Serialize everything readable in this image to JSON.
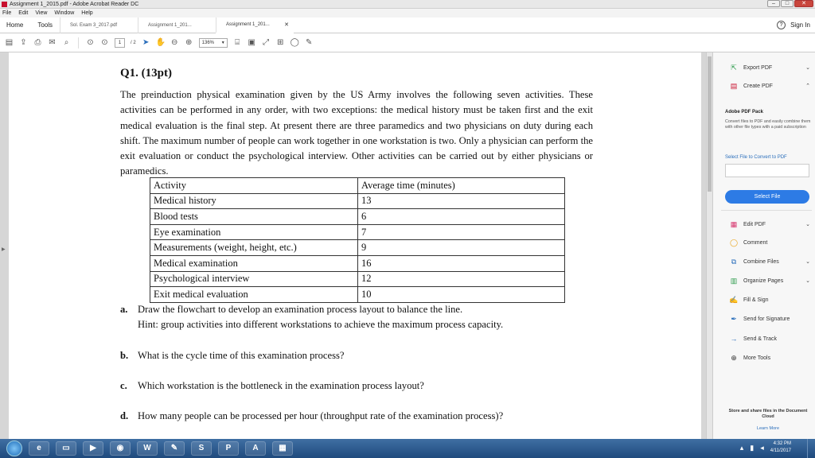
{
  "window": {
    "title": "Assignment 1_2015.pdf - Adobe Acrobat Reader DC"
  },
  "menu": [
    "File",
    "Edit",
    "View",
    "Window",
    "Help"
  ],
  "tabs": {
    "home": "Home",
    "tools": "Tools",
    "docs": [
      {
        "label": "Sol. Exam 3_2017.pdf",
        "active": false
      },
      {
        "label": "Assignment 1_201...",
        "active": false
      },
      {
        "label": "Assignment 1_201...",
        "active": true
      }
    ],
    "sign_in": "Sign In"
  },
  "toolbar": {
    "page_current": "1",
    "page_total": "/ 2",
    "zoom": "136%"
  },
  "document": {
    "question_title": "Q1. (13pt)",
    "paragraph": "The preinduction physical examination given by the US Army involves the following seven activities. These activities can be performed in any order, with two exceptions: the medical history must be taken first and the exit medical evaluation is the final step. At present there are three paramedics and two physicians on duty during each shift. The maximum number of people can work together in one workstation is two. Only a physician can perform the exit evaluation or conduct the psychological interview. Other activities can be carried out by either physicians or paramedics.",
    "table_headers": [
      "Activity",
      "Average time (minutes)"
    ],
    "table_rows": [
      [
        "Medical history",
        "13"
      ],
      [
        "Blood tests",
        "6"
      ],
      [
        "Eye examination",
        "7"
      ],
      [
        "Measurements (weight, height, etc.)",
        "9"
      ],
      [
        "Medical examination",
        "16"
      ],
      [
        "Psychological interview",
        "12"
      ],
      [
        "Exit medical evaluation",
        "10"
      ]
    ],
    "q_a_label": "a.",
    "q_a_text": "Draw the flowchart to develop an examination process layout to balance the line.",
    "q_a_hint": "Hint: group activities into different workstations to achieve the maximum process capacity.",
    "q_b_label": "b.",
    "q_b_text": "What is the cycle time of this examination process?",
    "q_c_label": "c.",
    "q_c_text": "Which workstation is the bottleneck in the examination process layout?",
    "q_d_label": "d.",
    "q_d_text": "How many people can be processed per hour (throughput rate of the examination process)?"
  },
  "right_panel": {
    "export_pdf": "Export PDF",
    "create_pdf": "Create PDF",
    "pack_title": "Adobe PDF Pack",
    "pack_desc": "Convert files to PDF and easily combine them with other file types with a paid subscription",
    "select_label": "Select File to Convert to PDF",
    "select_button": "Select File",
    "tools": [
      {
        "icon": "edit-pdf-icon",
        "label": "Edit PDF",
        "chevron": true
      },
      {
        "icon": "comment-icon",
        "label": "Comment",
        "chevron": false
      },
      {
        "icon": "combine-files-icon",
        "label": "Combine Files",
        "chevron": true
      },
      {
        "icon": "organize-pages-icon",
        "label": "Organize Pages",
        "chevron": true
      },
      {
        "icon": "fill-sign-icon",
        "label": "Fill & Sign",
        "chevron": false
      },
      {
        "icon": "send-for-signature-icon",
        "label": "Send for Signature",
        "chevron": false
      },
      {
        "icon": "send-track-icon",
        "label": "Send & Track",
        "chevron": false
      },
      {
        "icon": "more-tools-icon",
        "label": "More Tools",
        "chevron": false
      }
    ],
    "store_text": "Store and share files in the Document Cloud",
    "learn_more": "Learn More"
  },
  "taskbar": {
    "time": "4:32 PM",
    "date": "4/11/2017"
  },
  "colors": {
    "accent_blue": "#2d7be5",
    "acrobat_red": "#c8102e",
    "taskbar": "#1f4a7d"
  }
}
